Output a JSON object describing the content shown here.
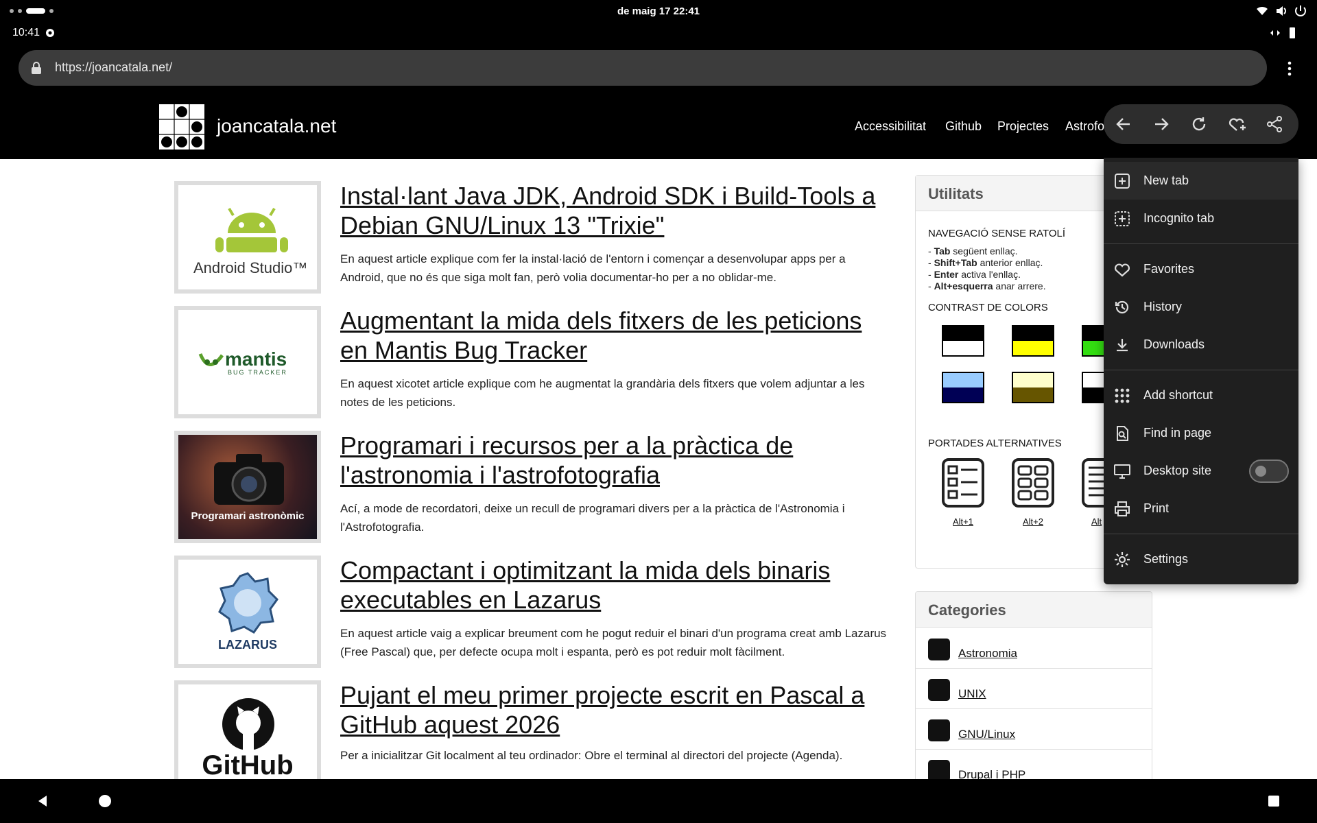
{
  "status": {
    "date_time": "de maig 17  22:41",
    "time": "10:41"
  },
  "browser": {
    "url": "https://joancatala.net/"
  },
  "site": {
    "title": "joancatala.net",
    "nav": [
      "Accessibilitat",
      "Github",
      "Projectes",
      "Astrofo"
    ]
  },
  "articles": [
    {
      "title": "Instal·lant Java JDK, Android SDK i Build-Tools a Debian GNU/Linux 13 \"Trixie\"",
      "summary": "En aquest article explique com fer la instal·lació de l'entorn i començar a desenvolupar apps per a Android, que no és que siga molt fan, però volia documentar-ho per a no oblidar-me.",
      "thumb_text": "Android Studio™"
    },
    {
      "title": "Augmentant la mida dels fitxers de les peticions en Mantis Bug Tracker",
      "summary": "En aquest xicotet article explique com he augmentat la grandària dels fitxers que volem adjuntar a les notes de les peticions.",
      "thumb_text": "mantis",
      "thumb_sub": "BUG TRACKER"
    },
    {
      "title": "Programari i recursos per a la pràctica de l'astronomia i l'astrofotografia",
      "summary": "Ací, a mode de recordatori, deixe un recull de programari divers per a la pràctica de l'Astronomia i l'Astrofotografia.",
      "thumb_text": "Programari astronòmic"
    },
    {
      "title": "Compactant i optimitzant la mida dels binaris executables en Lazarus",
      "summary": "En aquest article vaig a explicar breument com he pogut reduir el binari d'un programa creat amb Lazarus (Free Pascal) que, per defecte ocupa molt i espanta, però es pot reduir molt fàcilment.",
      "thumb_text": "LAZARUS"
    },
    {
      "title": "Pujant el meu primer projecte escrit en Pascal a GitHub aquest 2026",
      "summary": "Per a inicialitzar Git localment al teu ordinador: Obre el terminal al directori del projecte (Agenda).",
      "thumb_text": "GitHub"
    }
  ],
  "utilities": {
    "heading": "Utilitats",
    "nav_heading": "NAVEGACIÓ SENSE RATOLÍ",
    "shortcuts": [
      {
        "key": "Tab",
        "desc": " següent enllaç."
      },
      {
        "key": "Shift+Tab",
        "desc": " anterior enllaç."
      },
      {
        "key": "Enter",
        "desc": " activa l'enllaç."
      },
      {
        "key": "Alt+esquerra",
        "desc": " anar arrere."
      }
    ],
    "contrast_heading": "CONTRAST DE COLORS",
    "swatch_colors": [
      [
        "#000000",
        "#ffffff"
      ],
      [
        "#000000",
        "#ffff00"
      ],
      [
        "#000000",
        "#33dd11"
      ],
      [
        "#99ccff",
        "#000055"
      ],
      [
        "#ffffcc",
        "#665500"
      ],
      [
        "#ffffff",
        "#000000"
      ]
    ],
    "covers_heading": "PORTADES ALTERNATIVES",
    "covers": [
      "Alt+1",
      "Alt+2",
      "Alt"
    ]
  },
  "categories": {
    "heading": "Categories",
    "items": [
      "Astronomia",
      "UNIX",
      "GNU/Linux",
      "Drupal i PHP"
    ]
  },
  "menu": {
    "items": [
      "New tab",
      "Incognito tab",
      "Favorites",
      "History",
      "Downloads",
      "Add shortcut",
      "Find in page",
      "Desktop site",
      "Print",
      "Settings"
    ],
    "desktop_site_on": false
  }
}
